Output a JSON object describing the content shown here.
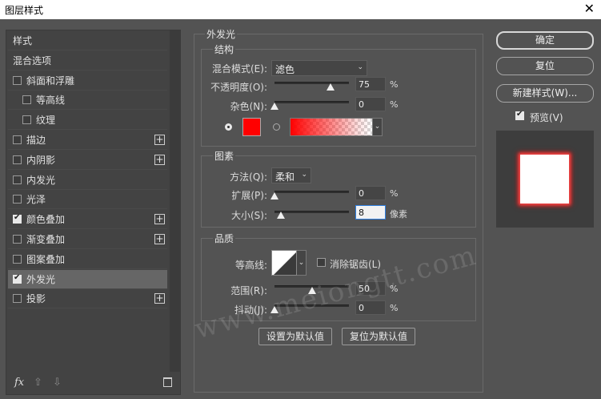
{
  "window": {
    "title": "图层样式",
    "close_glyph": "✕"
  },
  "left": {
    "items": [
      {
        "label": "样式",
        "checkbox": false,
        "checked": false,
        "plus": false,
        "indent": 0,
        "selected": false
      },
      {
        "label": "混合选项",
        "checkbox": false,
        "checked": false,
        "plus": false,
        "indent": 0,
        "selected": false
      },
      {
        "label": "斜面和浮雕",
        "checkbox": true,
        "checked": false,
        "plus": false,
        "indent": 0,
        "selected": false
      },
      {
        "label": "等高线",
        "checkbox": true,
        "checked": false,
        "plus": false,
        "indent": 1,
        "selected": false
      },
      {
        "label": "纹理",
        "checkbox": true,
        "checked": false,
        "plus": false,
        "indent": 1,
        "selected": false
      },
      {
        "label": "描边",
        "checkbox": true,
        "checked": false,
        "plus": true,
        "indent": 0,
        "selected": false
      },
      {
        "label": "内阴影",
        "checkbox": true,
        "checked": false,
        "plus": true,
        "indent": 0,
        "selected": false
      },
      {
        "label": "内发光",
        "checkbox": true,
        "checked": false,
        "plus": false,
        "indent": 0,
        "selected": false
      },
      {
        "label": "光泽",
        "checkbox": true,
        "checked": false,
        "plus": false,
        "indent": 0,
        "selected": false
      },
      {
        "label": "颜色叠加",
        "checkbox": true,
        "checked": true,
        "plus": true,
        "indent": 0,
        "selected": false
      },
      {
        "label": "渐变叠加",
        "checkbox": true,
        "checked": false,
        "plus": true,
        "indent": 0,
        "selected": false
      },
      {
        "label": "图案叠加",
        "checkbox": true,
        "checked": false,
        "plus": false,
        "indent": 0,
        "selected": false
      },
      {
        "label": "外发光",
        "checkbox": true,
        "checked": true,
        "plus": false,
        "indent": 0,
        "selected": true
      },
      {
        "label": "投影",
        "checkbox": true,
        "checked": false,
        "plus": true,
        "indent": 0,
        "selected": false
      }
    ],
    "bottom": {
      "fx": "fx",
      "up": "⇧",
      "down": "⇩",
      "trash": "🗑"
    }
  },
  "outer_glow": {
    "title": "外发光",
    "structure": {
      "title": "结构",
      "blend_mode_label": "混合模式(E):",
      "blend_mode_value": "滤色",
      "opacity_label": "不透明度(O):",
      "opacity_value": "75",
      "opacity_level": 75,
      "noise_label": "杂色(N):",
      "noise_value": "0",
      "noise_level": 0,
      "percent": "%",
      "color": "#ff0000"
    },
    "elements": {
      "title": "图素",
      "method_label": "方法(Q):",
      "method_value": "柔和",
      "spread_label": "扩展(P):",
      "spread_value": "0",
      "spread_level": 0,
      "size_label": "大小(S):",
      "size_value": "8",
      "size_unit": "像素",
      "percent": "%"
    },
    "quality": {
      "title": "品质",
      "contour_label": "等高线:",
      "antialias_label": "消除锯齿(L)",
      "range_label": "范围(R):",
      "range_value": "50",
      "range_level": 50,
      "jitter_label": "抖动(J):",
      "jitter_value": "0",
      "jitter_level": 0,
      "percent": "%"
    },
    "buttons": {
      "make_default": "设置为默认值",
      "reset_default": "复位为默认值"
    }
  },
  "right": {
    "ok": "确定",
    "reset": "复位",
    "new_style": "新建样式(W)...",
    "preview_label": "预览(V)",
    "preview_checked": true
  },
  "watermark": "www.meiongtt.com"
}
